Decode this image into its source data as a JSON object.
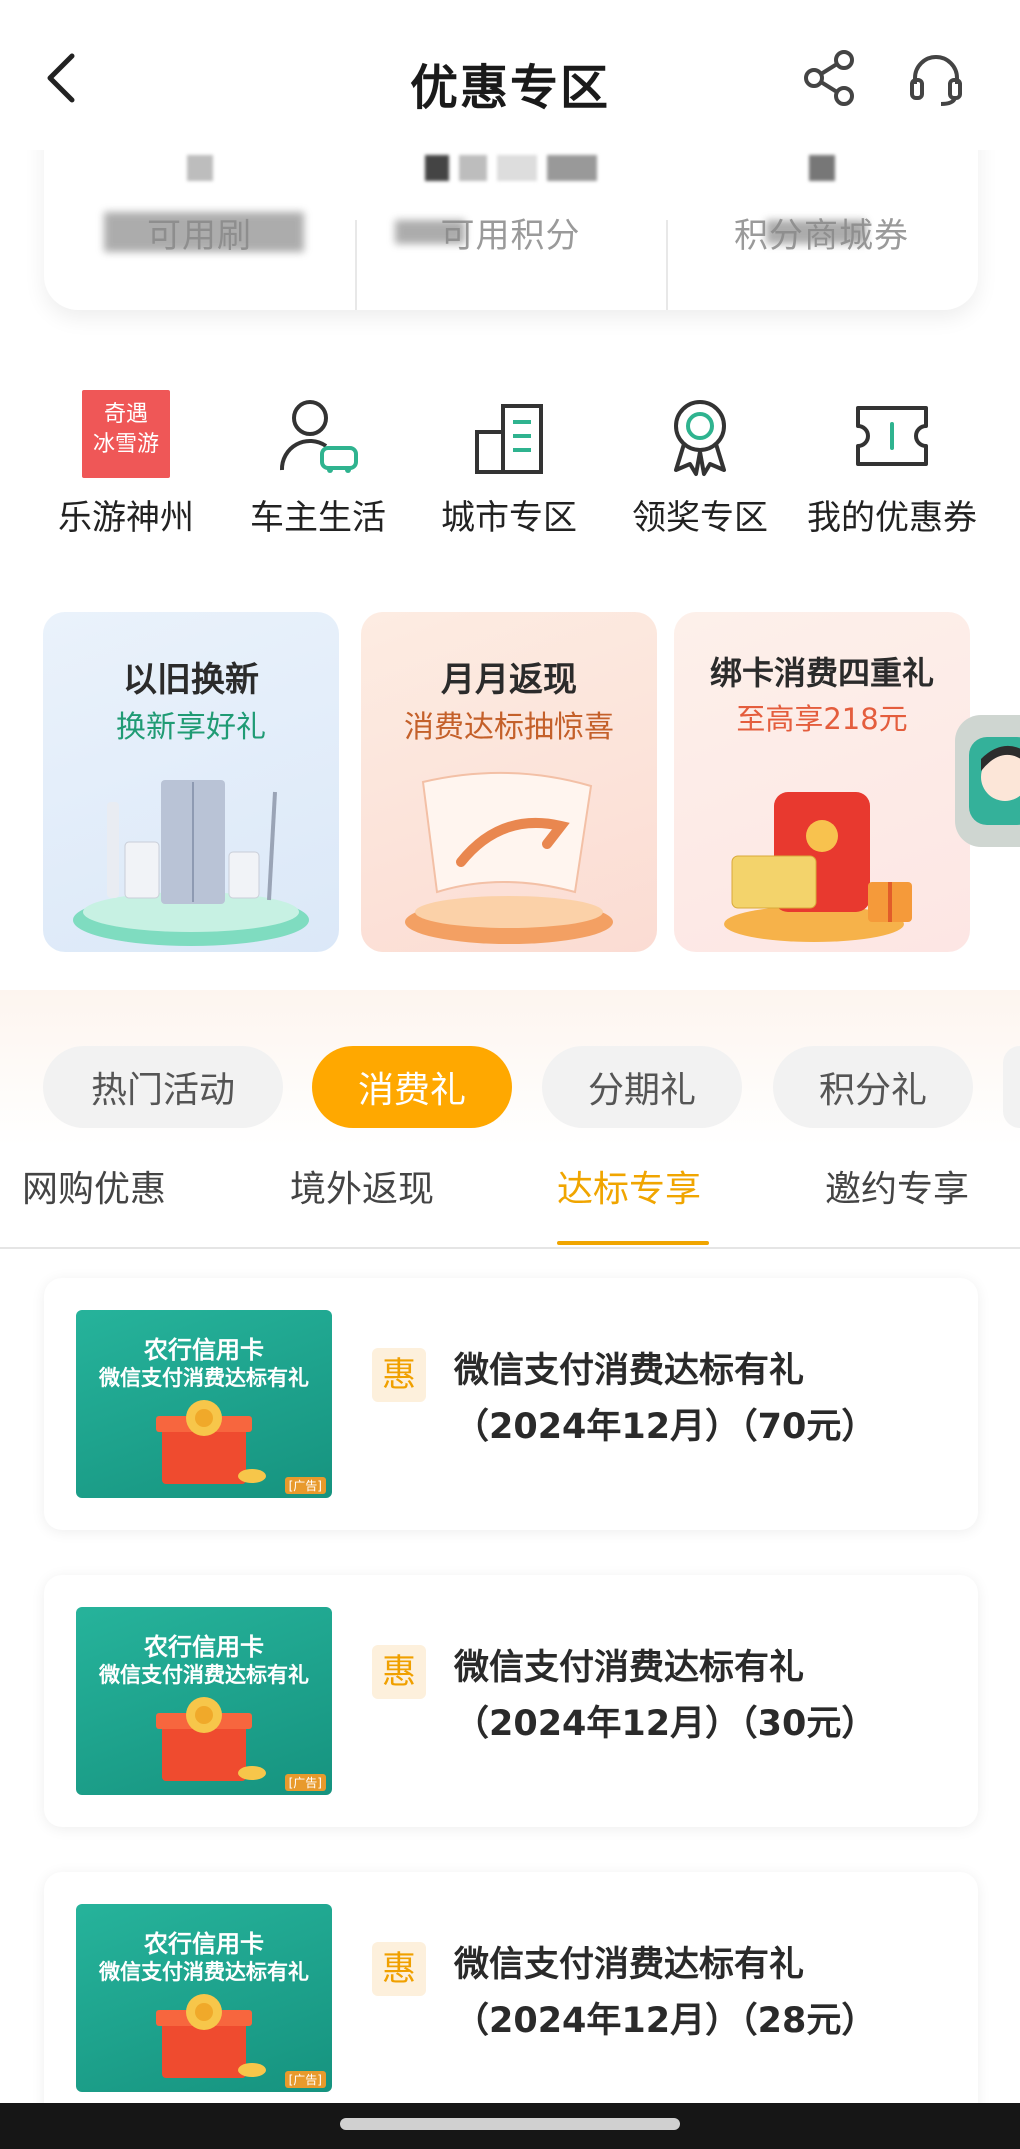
{
  "header": {
    "title": "优惠专区",
    "back_icon": "chevron-left-icon",
    "share_icon": "share-icon",
    "service_icon": "headset-icon"
  },
  "points": {
    "items": [
      {
        "label": "可用刷"
      },
      {
        "label": "可用积分"
      },
      {
        "label": "积分商城券"
      }
    ]
  },
  "quick_nav": [
    {
      "label": "乐游神州",
      "icon": "promo-logo",
      "logo_text": [
        "奇遇",
        "冰雪游"
      ]
    },
    {
      "label": "车主生活",
      "icon": "car-owner-icon"
    },
    {
      "label": "城市专区",
      "icon": "city-icon"
    },
    {
      "label": "领奖专区",
      "icon": "award-icon"
    },
    {
      "label": "我的优惠券",
      "icon": "coupon-icon"
    }
  ],
  "banners": [
    {
      "title": "以旧换新",
      "subtitle": "换新享好礼",
      "accent": "#1f9b74"
    },
    {
      "title": "月月返现",
      "subtitle": "消费达标抽惊喜",
      "accent": "#c4602a"
    },
    {
      "title": "绑卡消费四重礼",
      "subtitle": "至高享218元",
      "accent": "#e45d3d"
    }
  ],
  "tabs": {
    "pills": [
      {
        "label": "热门活动",
        "active": false
      },
      {
        "label": "消费礼",
        "active": true
      },
      {
        "label": "分期礼",
        "active": false
      },
      {
        "label": "积分礼",
        "active": false
      }
    ],
    "subtabs": [
      {
        "label": "网购优惠",
        "active": false
      },
      {
        "label": "境外返现",
        "active": false
      },
      {
        "label": "达标专享",
        "active": true
      },
      {
        "label": "邀约专享",
        "active": false
      }
    ]
  },
  "activities": [
    {
      "badge": "惠",
      "title": "微信支付消费达标有礼",
      "subtitle": "（2024年12月）（70元）",
      "thumb_title": "农行信用卡",
      "thumb_sub": "微信支付消费达标有礼",
      "thumb_ad": "[广告]"
    },
    {
      "badge": "惠",
      "title": "微信支付消费达标有礼",
      "subtitle": "（2024年12月）（30元）",
      "thumb_title": "农行信用卡",
      "thumb_sub": "微信支付消费达标有礼",
      "thumb_ad": "[广告]"
    },
    {
      "badge": "惠",
      "title": "微信支付消费达标有礼",
      "subtitle": "（2024年12月）（28元）",
      "thumb_title": "农行信用卡",
      "thumb_sub": "微信支付消费达标有礼",
      "thumb_ad": "[广告]"
    }
  ],
  "colors": {
    "accent": "#ffa800",
    "active_tab": "#f0a500",
    "badge_bg": "#fdf0dc"
  }
}
